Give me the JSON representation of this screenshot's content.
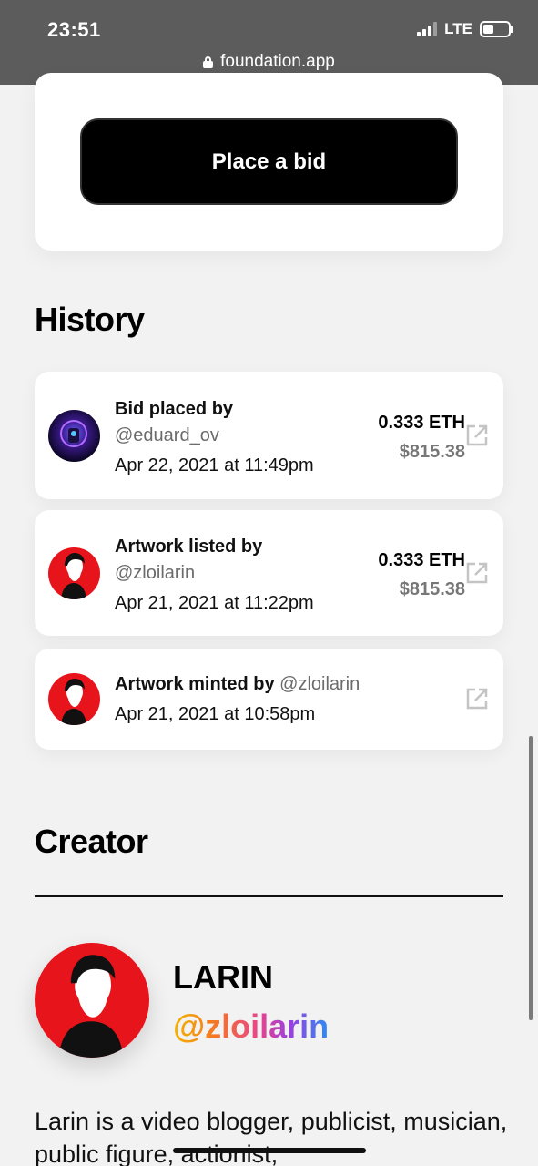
{
  "status_bar": {
    "time": "23:51",
    "network": "LTE"
  },
  "browser": {
    "url": "foundation.app"
  },
  "bid_card": {
    "button_label": "Place a bid"
  },
  "history": {
    "title": "History",
    "items": [
      {
        "action": "Bid placed by",
        "handle": "@eduard_ov",
        "date": "Apr 22, 2021 at 11:49pm",
        "eth": "0.333 ETH",
        "usd": "$815.38",
        "avatar": "purple-neon-avatar"
      },
      {
        "action": "Artwork listed by",
        "handle": "@zloilarin",
        "date": "Apr 21, 2021 at 11:22pm",
        "eth": "0.333 ETH",
        "usd": "$815.38",
        "avatar": "red-silhouette-avatar"
      },
      {
        "action": "Artwork minted by",
        "handle": "@zloilarin",
        "date": "Apr 21, 2021 at 10:58pm",
        "avatar": "red-silhouette-avatar"
      }
    ]
  },
  "creator": {
    "title": "Creator",
    "name": "LARIN",
    "handle": "@zloilarin",
    "bio": "Larin is a video blogger, publicist, musician, public figure, actionist,"
  },
  "colors": {
    "background": "#f2f2f2",
    "card": "#ffffff",
    "button": "#000000",
    "avatar_red": "#e8141b",
    "topbar": "#5c5c5c"
  }
}
